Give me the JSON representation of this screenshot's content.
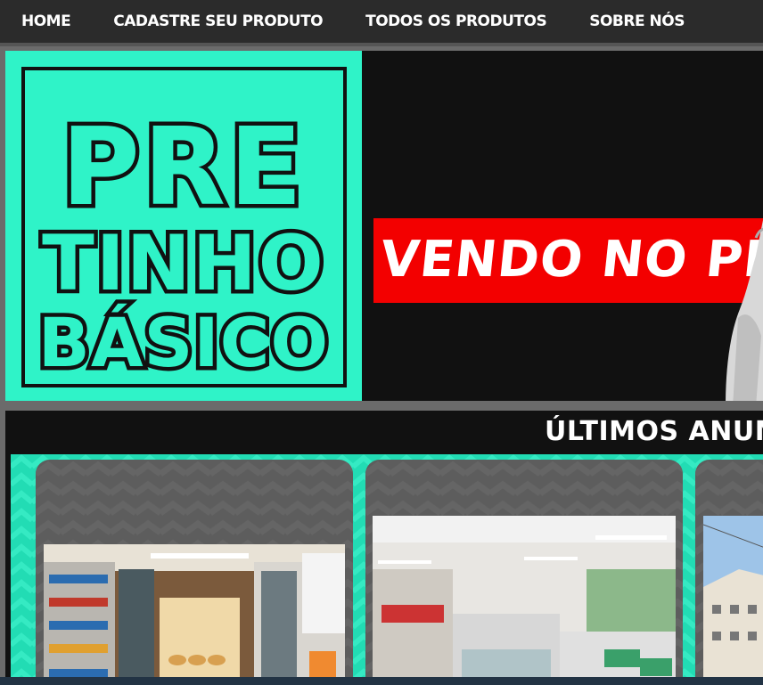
{
  "nav": {
    "items": [
      "HOME",
      "CADASTRE SEU PRODUTO",
      "TODOS OS PRODUTOS",
      "SOBRE NÓS"
    ]
  },
  "logo": {
    "lines": [
      "PRE",
      "TINHO",
      "BÁSICO"
    ],
    "background": "#2ff3c8"
  },
  "hero": {
    "banner_text": "VENDO NO PB",
    "banner_color": "#f30000"
  },
  "section": {
    "title": "ÚLTIMOS ANUNCIA"
  },
  "colors": {
    "accent": "#2ff3c8",
    "nav_bg": "#2b2b2b",
    "card_bg": "#5d5d5d"
  }
}
